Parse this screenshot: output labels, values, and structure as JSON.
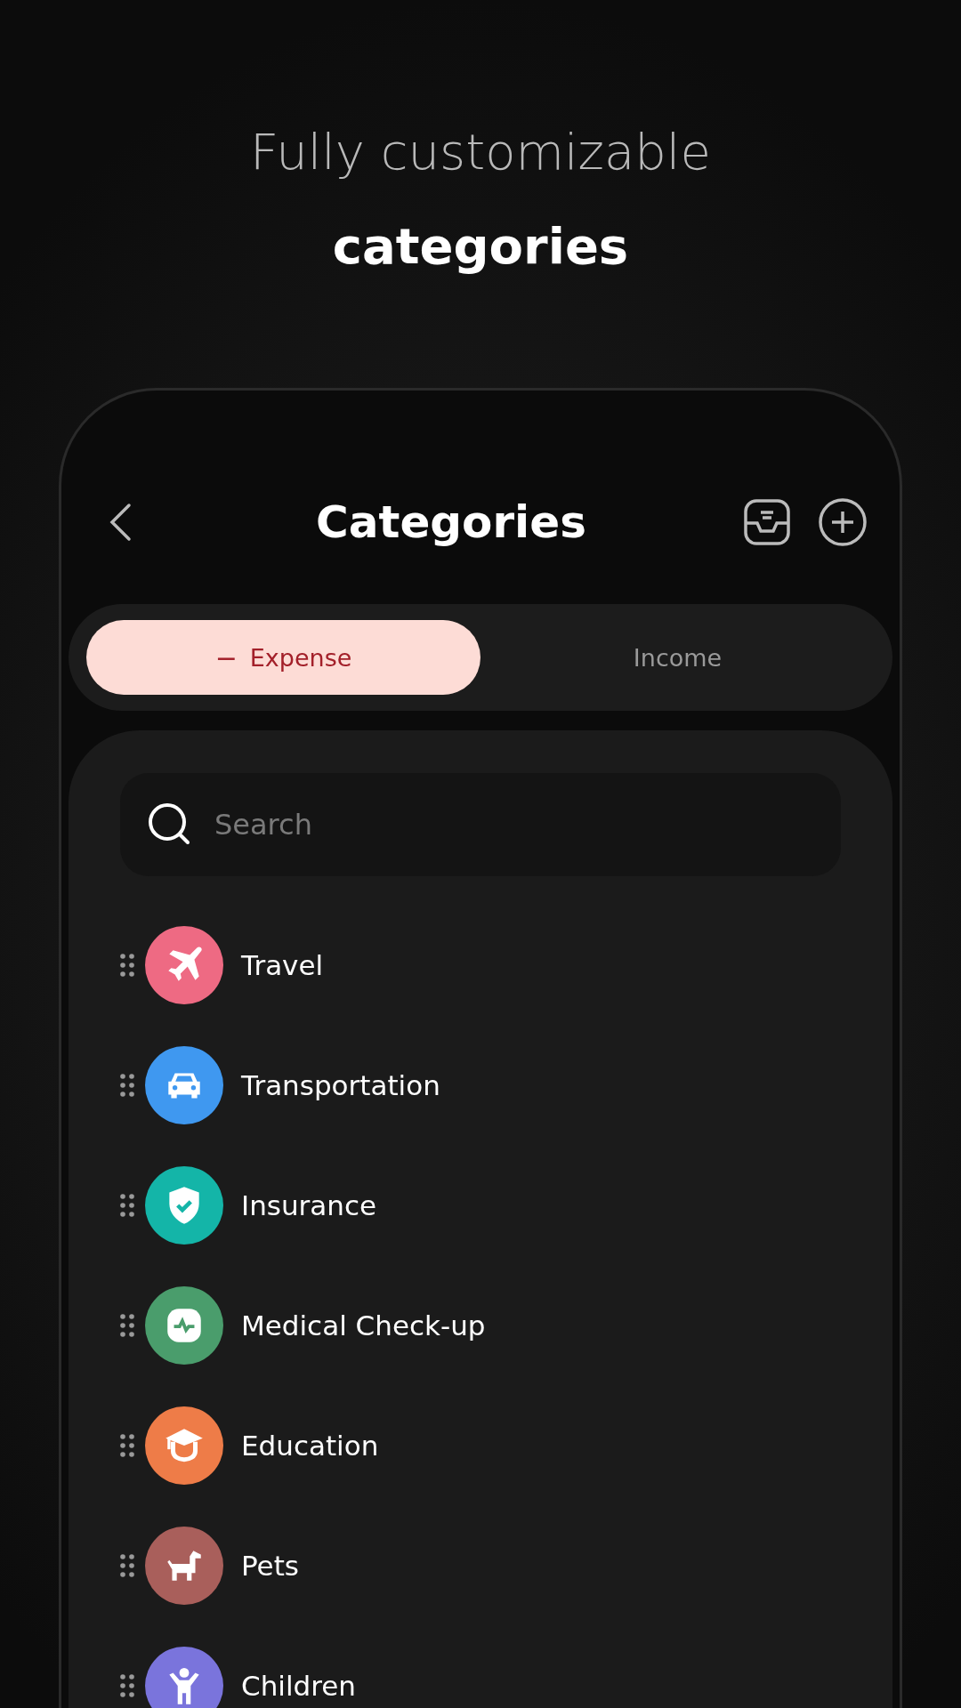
{
  "headline": {
    "line1": "Fully customizable",
    "line2": "categories"
  },
  "screen": {
    "title": "Categories",
    "tabs": [
      {
        "label": "Expense",
        "selected": true,
        "sign": "−"
      },
      {
        "label": "Income",
        "selected": false
      }
    ],
    "search": {
      "placeholder": "Search"
    },
    "categories": [
      {
        "name": "Travel",
        "kind": "plane",
        "color": "#ee6a83"
      },
      {
        "name": "Transportation",
        "kind": "car",
        "color": "#3f98f0"
      },
      {
        "name": "Insurance",
        "kind": "shield",
        "color": "#14b5a8"
      },
      {
        "name": "Medical Check-up",
        "kind": "pulse",
        "color": "#4a9d6c"
      },
      {
        "name": "Education",
        "kind": "cap",
        "color": "#ee7c48"
      },
      {
        "name": "Pets",
        "kind": "dog",
        "color": "#a95f5b"
      },
      {
        "name": "Children",
        "kind": "child",
        "color": "#7a74dc"
      }
    ]
  }
}
